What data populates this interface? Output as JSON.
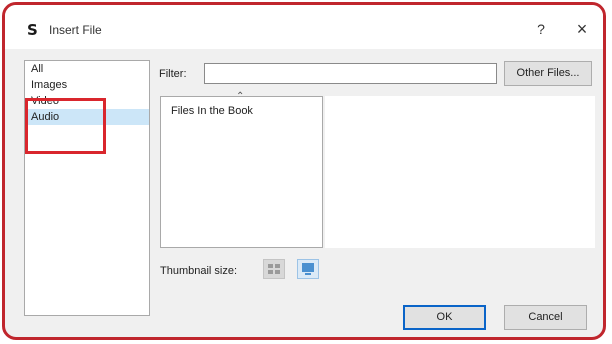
{
  "window": {
    "title": "Insert File",
    "app_icon_glyph": "S",
    "help_label": "?",
    "close_label": "×"
  },
  "categories": {
    "items": [
      {
        "label": "All",
        "selected": false
      },
      {
        "label": "Images",
        "selected": false
      },
      {
        "label": "Video",
        "selected": false
      },
      {
        "label": "Audio",
        "selected": true
      }
    ],
    "highlighted": [
      "Video",
      "Audio"
    ]
  },
  "filter": {
    "label": "Filter:",
    "value": "",
    "other_files_label": "Other Files..."
  },
  "book_list": {
    "items": [
      "Files In the Book"
    ]
  },
  "thumbnail": {
    "label": "Thumbnail size:",
    "small_icon": "small-thumbnail-icon",
    "large_icon": "large-thumbnail-icon",
    "selected": "large"
  },
  "buttons": {
    "ok_label": "OK",
    "cancel_label": "Cancel"
  },
  "colors": {
    "highlight_border": "#d9262d",
    "frame_border": "#c0262d",
    "selection": "#cce6f8",
    "ok_border": "#0a64c8"
  }
}
